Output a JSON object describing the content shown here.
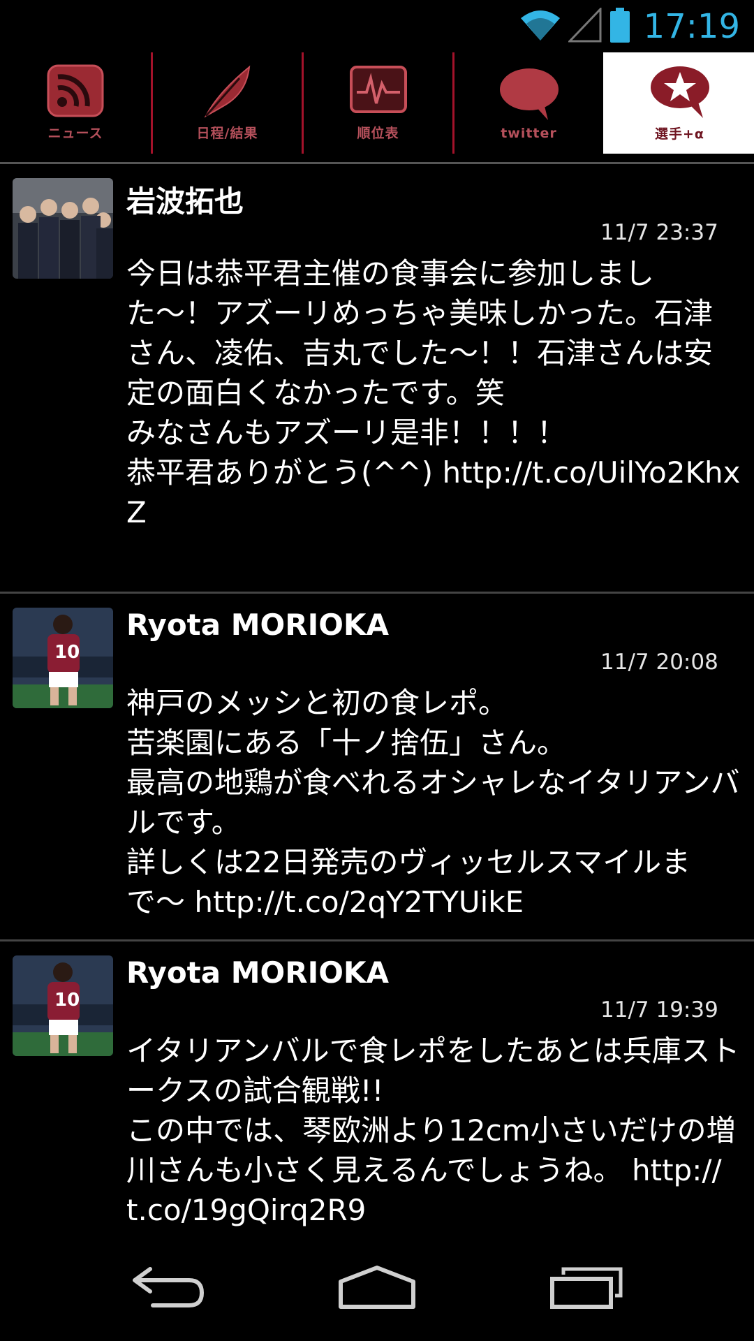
{
  "status_bar": {
    "time": "17:19",
    "icons": [
      "wifi-icon",
      "cell-signal-icon",
      "battery-icon"
    ],
    "accent_color": "#33b5e5"
  },
  "tabs": [
    {
      "label": "ニュース",
      "icon": "rss-icon",
      "active": false
    },
    {
      "label": "日程/結果",
      "icon": "feather-icon",
      "active": false
    },
    {
      "label": "順位表",
      "icon": "chart-monitor-icon",
      "active": false
    },
    {
      "label": "twitter",
      "icon": "speech-bubble-icon",
      "active": false
    },
    {
      "label": "選手+α",
      "icon": "star-bubble-icon",
      "active": true
    }
  ],
  "tweets": [
    {
      "name": "岩波拓也",
      "time": "11/7 23:37",
      "text": "今日は恭平君主催の食事会に参加しました〜！アズーリめっちゃ美味しかった。石津さん、凌佑、吉丸でした〜！！石津さんは安定の面白くなかったです。笑\nみなさんもアズーリ是非！！！！\n恭平君ありがとう(^^) http://t.co/UilYo2KhxZ"
    },
    {
      "name": "Ryota MORIOKA",
      "time": "11/7 20:08",
      "text": "神戸のメッシと初の食レポ。\n苦楽園にある「十ノ捨伍」さん。\n最高の地鶏が食べれるオシャレなイタリアンバルです。\n詳しくは22日発売のヴィッセルスマイルまで〜 http://t.co/2qY2TYUikE"
    },
    {
      "name": "Ryota MORIOKA",
      "time": "11/7 19:39",
      "text": "イタリアンバルで食レポをしたあとは兵庫ストークスの試合観戦!!\nこの中では、琴欧洲より12cm小さいだけの増川さんも小さく見えるんでしょうね。 http://t.co/19gQirq2R9"
    }
  ],
  "nav_bar": {
    "buttons": [
      "back-icon",
      "home-icon",
      "recent-apps-icon"
    ]
  },
  "colors": {
    "brand_red": "#a3122a",
    "tab_label": "#b5505b",
    "background": "#000000"
  }
}
